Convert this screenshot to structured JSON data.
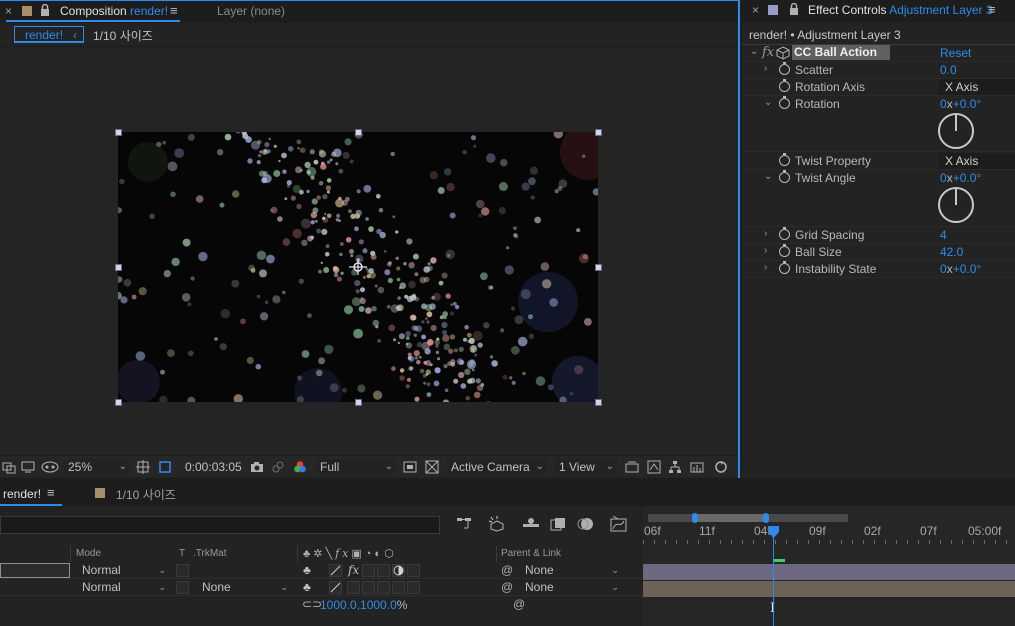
{
  "comp_panel": {
    "tab_label": "Composition",
    "comp_name": "render!",
    "layer_tab": "Layer (none)",
    "breadcrumb_comp": "render!",
    "breadcrumb_sub": "1/10 사이즈"
  },
  "viewer_toolbar": {
    "zoom": "25%",
    "timecode": "0:00:03:05",
    "resolution": "Full",
    "camera": "Active Camera",
    "views": "1 View"
  },
  "effect_controls": {
    "tab_label": "Effect Controls",
    "layer_name": "Adjustment Layer 3",
    "path": "render! • Adjustment Layer 3",
    "effect_name": "CC Ball Action",
    "reset_label": "Reset",
    "fx_label": "fx",
    "properties": {
      "scatter": {
        "name": "Scatter",
        "value": "0.0"
      },
      "rotation_axis": {
        "name": "Rotation Axis",
        "value": "X Axis"
      },
      "rotation": {
        "name": "Rotation",
        "value_rev": "0",
        "value_x": "x",
        "value_deg": "+0.0°"
      },
      "twist_property": {
        "name": "Twist Property",
        "value": "X Axis"
      },
      "twist_angle": {
        "name": "Twist Angle",
        "value_rev": "0",
        "value_x": "x",
        "value_deg": "+0.0°"
      },
      "grid_spacing": {
        "name": "Grid Spacing",
        "value": "4"
      },
      "ball_size": {
        "name": "Ball Size",
        "value": "42.0"
      },
      "instability_state": {
        "name": "Instability State",
        "value_rev": "0",
        "value_x": "x",
        "value_deg": "+0.0°"
      }
    }
  },
  "timeline": {
    "tab_comp": "render!",
    "tab_sub": "1/10 사이즈",
    "headers": {
      "mode": "Mode",
      "t": "T",
      "trkmat": ".TrkMat",
      "parent": "Parent & Link"
    },
    "rows": [
      {
        "mode": "Normal",
        "trkmat": "",
        "parent": "None"
      },
      {
        "mode": "Normal",
        "trkmat": "None",
        "parent": "None"
      }
    ],
    "scale_value": "1000.0,1000.0",
    "scale_unit": "%",
    "ruler": [
      "06f",
      "11f",
      "04f",
      "09f",
      "02f",
      "07f",
      "05:00f"
    ]
  },
  "colors": {
    "accent": "#2d8ceb",
    "label_tan": "#a98e6a",
    "layer_bar": "#6e6880",
    "adj_bar": "#6a6356",
    "playhead": "#2d8ceb"
  }
}
